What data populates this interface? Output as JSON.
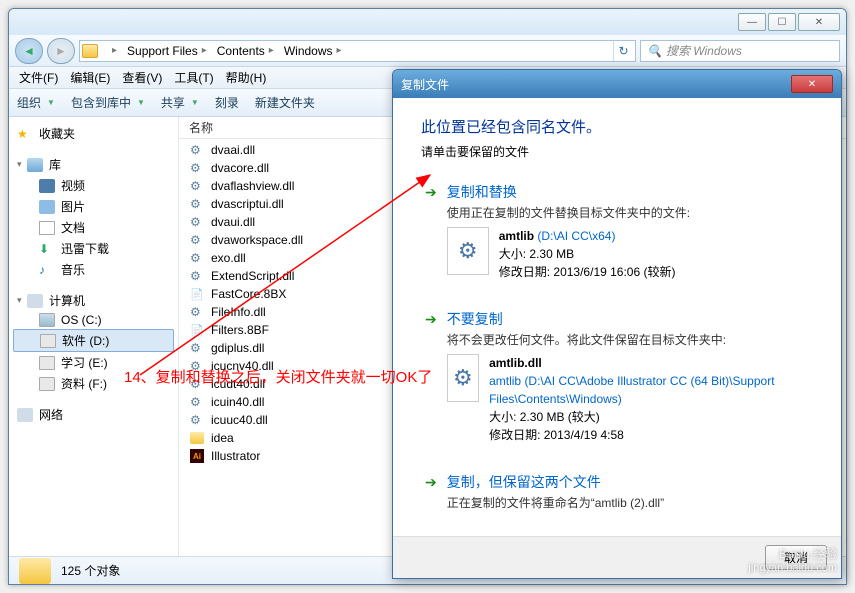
{
  "window": {
    "min": "—",
    "max": "☐",
    "close": "✕"
  },
  "breadcrumb": {
    "items": [
      "Support Files",
      "Contents",
      "Windows"
    ]
  },
  "search": {
    "placeholder": "搜索 Windows"
  },
  "menubar": {
    "items": [
      "文件(F)",
      "编辑(E)",
      "查看(V)",
      "工具(T)",
      "帮助(H)"
    ]
  },
  "toolbar": {
    "organize": "组织",
    "include": "包含到库中",
    "share": "共享",
    "burn": "刻录",
    "newfolder": "新建文件夹"
  },
  "sidebar": {
    "favorites": "收藏夹",
    "libraries": "库",
    "lib_items": [
      "视频",
      "图片",
      "文档",
      "迅雷下载",
      "音乐"
    ],
    "computer": "计算机",
    "drives": [
      "OS (C:)",
      "软件 (D:)",
      "学习 (E:)",
      "资料 (F:)"
    ],
    "network": "网络"
  },
  "column_header": "名称",
  "files": [
    {
      "name": "dvaai.dll",
      "type": "dll"
    },
    {
      "name": "dvacore.dll",
      "type": "dll"
    },
    {
      "name": "dvaflashview.dll",
      "type": "dll"
    },
    {
      "name": "dvascriptui.dll",
      "type": "dll"
    },
    {
      "name": "dvaui.dll",
      "type": "dll"
    },
    {
      "name": "dvaworkspace.dll",
      "type": "dll"
    },
    {
      "name": "exo.dll",
      "type": "dll"
    },
    {
      "name": "ExtendScript.dll",
      "type": "dll"
    },
    {
      "name": "FastCore.8BX",
      "type": "txt"
    },
    {
      "name": "FileInfo.dll",
      "type": "dll"
    },
    {
      "name": "Filters.8BF",
      "type": "txt"
    },
    {
      "name": "gdiplus.dll",
      "type": "dll"
    },
    {
      "name": "icucnv40.dll",
      "type": "dll"
    },
    {
      "name": "icudt40.dll",
      "type": "dll"
    },
    {
      "name": "icuin40.dll",
      "type": "dll"
    },
    {
      "name": "icuuc40.dll",
      "type": "dll"
    },
    {
      "name": "idea",
      "type": "folder"
    },
    {
      "name": "Illustrator",
      "type": "ai"
    }
  ],
  "statusbar": {
    "count": "125 个对象"
  },
  "dialog": {
    "title": "复制文件",
    "heading": "此位置已经包含同名文件。",
    "subheading": "请单击要保留的文件",
    "opt1": {
      "title": "复制和替换",
      "desc": "使用正在复制的文件替换目标文件夹中的文件:",
      "fname": "amtlib",
      "fpath": "(D:\\AI   CC\\x64)",
      "size": "大小: 2.30 MB",
      "date": "修改日期: 2013/6/19 16:06 (较新)"
    },
    "opt2": {
      "title": "不要复制",
      "desc": "将不会更改任何文件。将此文件保留在目标文件夹中:",
      "fname": "amtlib.dll",
      "fpath": "amtlib (D:\\AI   CC\\Adobe Illustrator CC (64 Bit)\\Support Files\\Contents\\Windows)",
      "size": "大小: 2.30 MB (较大)",
      "date": "修改日期: 2013/4/19 4:58"
    },
    "opt3": {
      "title": "复制，但保留这两个文件",
      "desc": "正在复制的文件将重命名为“amtlib (2).dll”"
    },
    "cancel": "取消"
  },
  "annotation": "14、复制和替换之后，关闭文件夹就一切OK了",
  "watermark": {
    "main": "Baidu 经验",
    "sub": "jingyan.baidu.com"
  }
}
